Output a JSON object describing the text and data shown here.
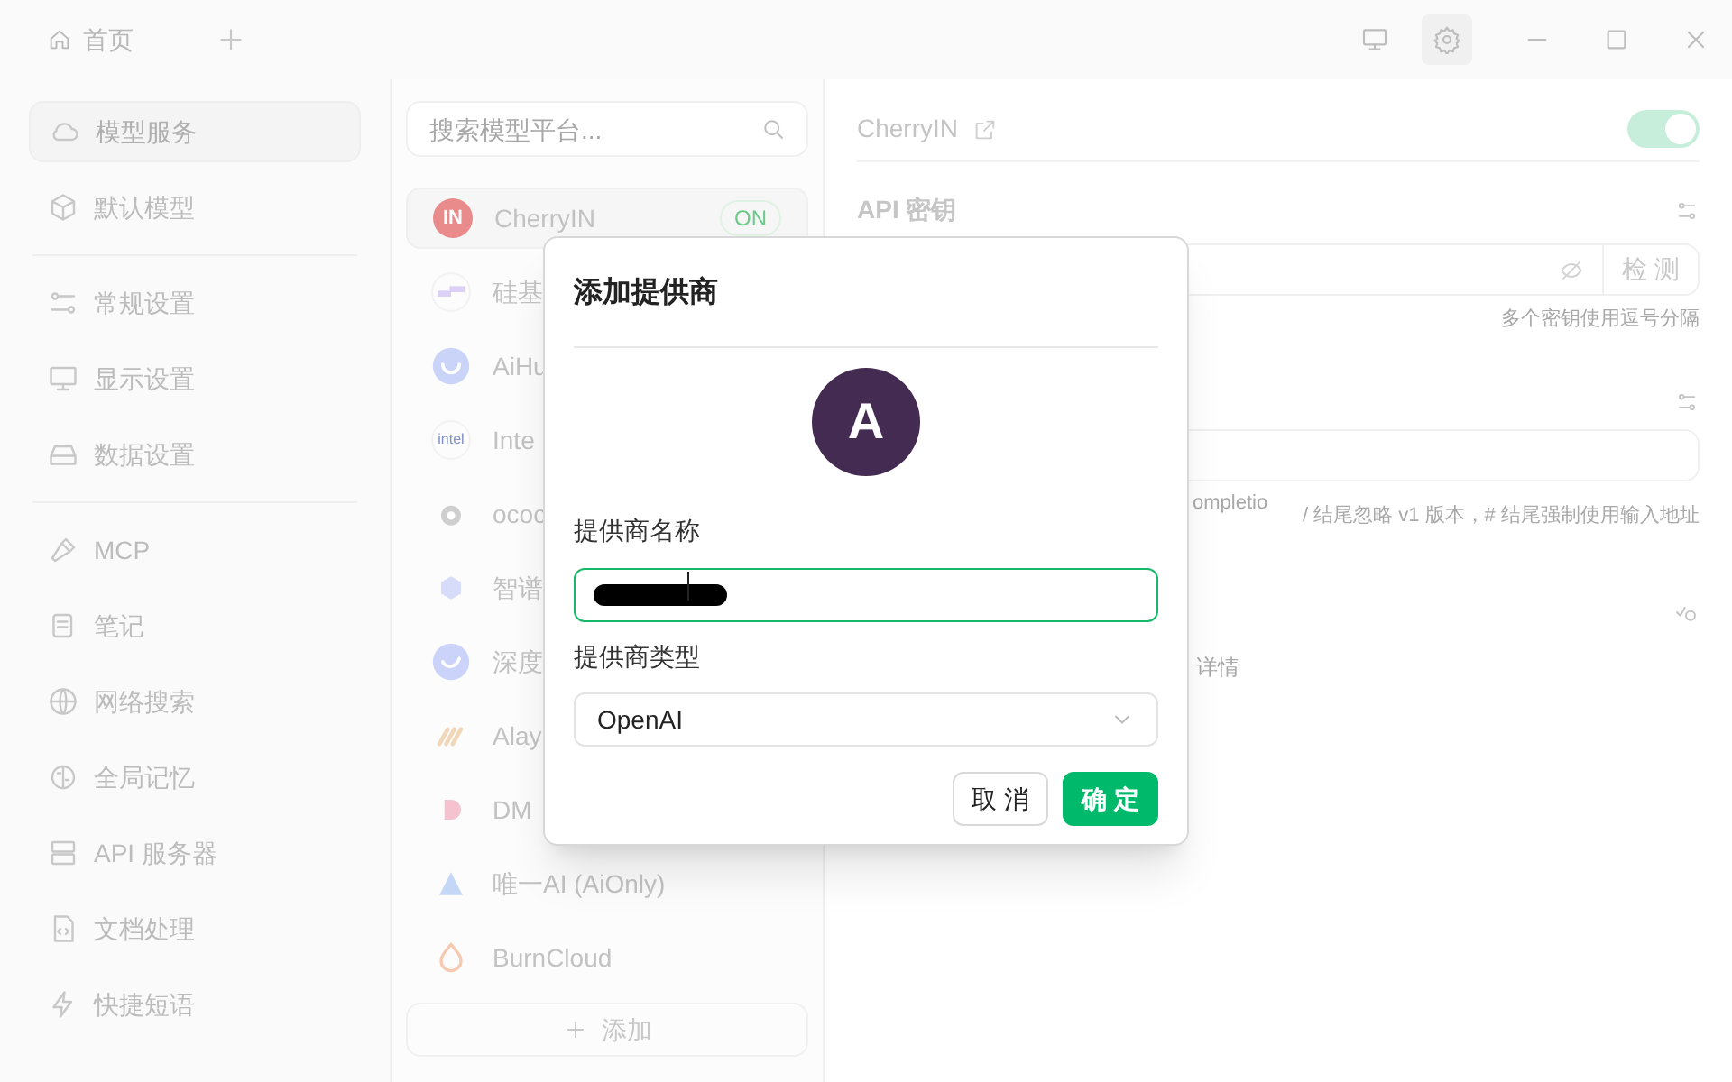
{
  "title_bar": {
    "home_tab": "首页"
  },
  "sidebar": {
    "groups": [
      {
        "items": [
          {
            "label": "模型服务",
            "selected": true
          },
          {
            "label": "默认模型",
            "selected": false
          }
        ]
      },
      {
        "items": [
          {
            "label": "常规设置",
            "selected": false
          },
          {
            "label": "显示设置",
            "selected": false
          },
          {
            "label": "数据设置",
            "selected": false
          }
        ]
      },
      {
        "items": [
          {
            "label": "MCP",
            "selected": false
          },
          {
            "label": "笔记",
            "selected": false
          },
          {
            "label": "网络搜索",
            "selected": false
          },
          {
            "label": "全局记忆",
            "selected": false
          },
          {
            "label": "API 服务器",
            "selected": false
          },
          {
            "label": "文档处理",
            "selected": false
          },
          {
            "label": "快捷短语",
            "selected": false
          }
        ]
      }
    ]
  },
  "providers": {
    "search": {
      "placeholder": "搜索模型平台..."
    },
    "items": [
      {
        "name": "CherryIN",
        "selected": true,
        "badge": "ON",
        "logo_text": "IN"
      },
      {
        "name": "硅基",
        "selected": false
      },
      {
        "name": "AiHu",
        "selected": false
      },
      {
        "name": "Inte",
        "selected": false,
        "logo_text": "intel"
      },
      {
        "name": "ococ",
        "selected": false
      },
      {
        "name": "智谱",
        "selected": false
      },
      {
        "name": "深度",
        "selected": false
      },
      {
        "name": "Alay",
        "selected": false
      },
      {
        "name": "DM",
        "selected": false
      },
      {
        "name": "唯一AI (AiOnly)",
        "selected": false
      },
      {
        "name": "BurnCloud",
        "selected": false
      }
    ],
    "add_button": "添加"
  },
  "detail": {
    "title": "CherryIN",
    "enabled": true,
    "api_key_label": "API 密钥",
    "check_button": "检 测",
    "api_key_hint": "多个密钥使用逗号分隔",
    "url_hint_fragment": "ompletio",
    "url_hint": "/ 结尾忽略 v1 版本，# 结尾强制使用输入地址",
    "details_fragment": "详情"
  },
  "dialog": {
    "title": "添加提供商",
    "avatar": "A",
    "name_label": "提供商名称",
    "name_redacted": true,
    "type_label": "提供商类型",
    "type_value": "OpenAI",
    "buttons": [
      {
        "label": "取 消",
        "kind": "default"
      },
      {
        "label": "确 定",
        "kind": "primary"
      }
    ]
  }
}
